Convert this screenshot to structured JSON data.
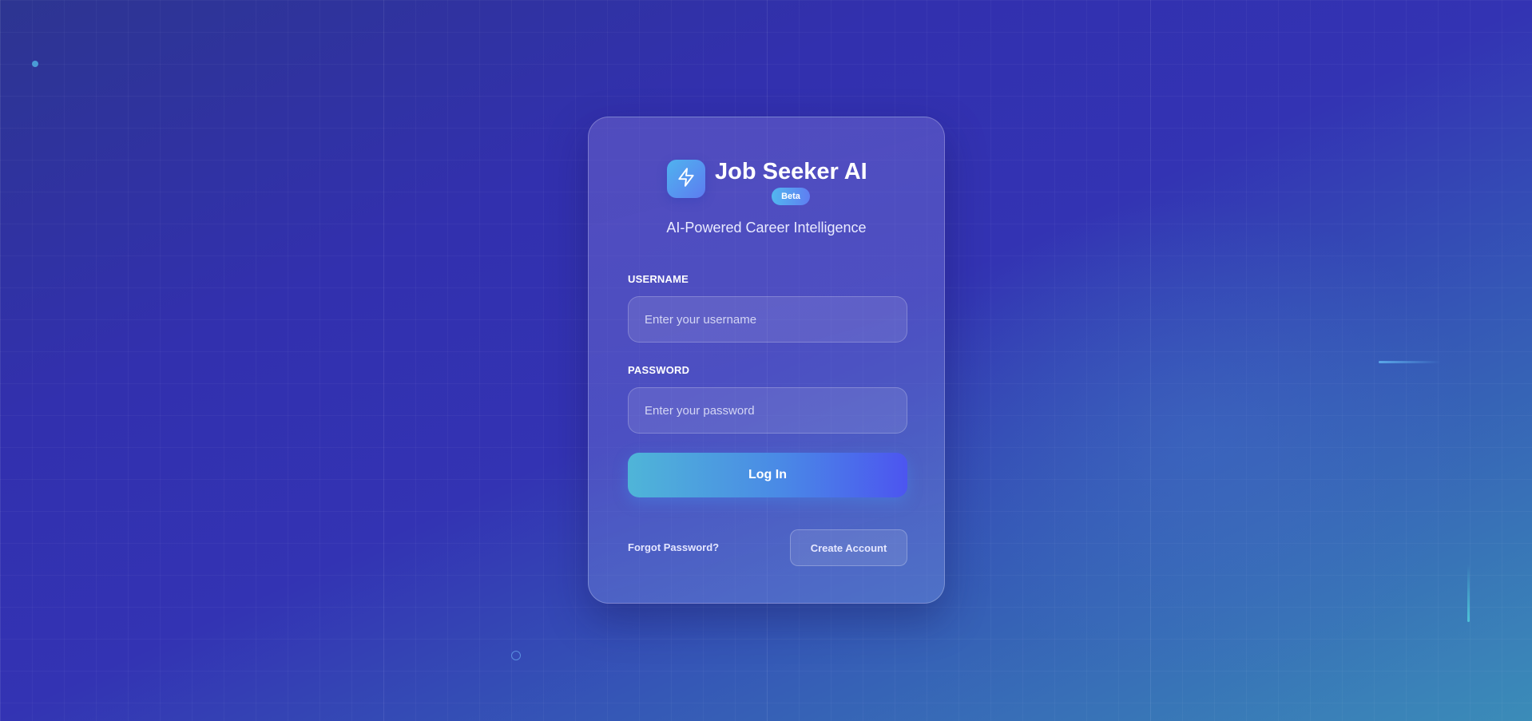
{
  "app": {
    "title": "Job Seeker AI",
    "badge": "Beta",
    "tagline": "AI-Powered Career Intelligence",
    "logo_icon": "lightning-bolt-icon"
  },
  "form": {
    "username": {
      "label": "USERNAME",
      "placeholder": "Enter your username",
      "value": ""
    },
    "password": {
      "label": "PASSWORD",
      "placeholder": "Enter your password",
      "value": ""
    },
    "login_label": "Log In",
    "forgot_label": "Forgot Password?",
    "create_label": "Create Account"
  },
  "colors": {
    "background_start": "#2d3591",
    "background_end": "#3b8cb8",
    "accent_start": "#4fb5d8",
    "accent_end": "#4c55f0"
  }
}
